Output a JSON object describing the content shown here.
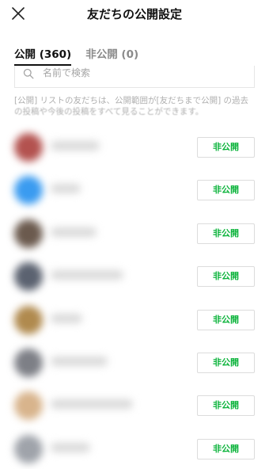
{
  "header": {
    "title": "友だちの公開設定"
  },
  "tabs": [
    {
      "label": "公開 (360)",
      "active": true
    },
    {
      "label": "非公開 (0)",
      "active": false
    }
  ],
  "search": {
    "placeholder": "名前で検索",
    "value": ""
  },
  "notice": {
    "line1": "[公開] リストの友だちは、公開範囲が[友だちまで公開] の過去",
    "line2": "の投稿や今後の投稿をすべて見ることができます。"
  },
  "friends": [
    {
      "avatar_color": "#b3524f",
      "button_label": "非公開"
    },
    {
      "avatar_color": "#3a9bf0",
      "button_label": "非公開"
    },
    {
      "avatar_color": "#6b5a4e",
      "button_label": "非公開"
    },
    {
      "avatar_color": "#5b6270",
      "button_label": "非公開"
    },
    {
      "avatar_color": "#b08a4e",
      "button_label": "非公開"
    },
    {
      "avatar_color": "#7d7f86",
      "button_label": "非公開"
    },
    {
      "avatar_color": "#d8b48c",
      "button_label": "非公開"
    },
    {
      "avatar_color": "#9fa3aa",
      "button_label": "非公開"
    }
  ],
  "colors": {
    "accent": "#0ab33a",
    "text": "#1e1e1e",
    "muted": "#8a8a8a"
  }
}
